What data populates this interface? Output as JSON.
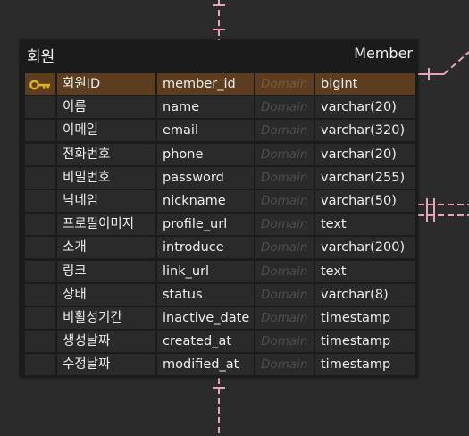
{
  "entity": {
    "logical_name": "회원",
    "physical_name": "Member",
    "domain_placeholder": "Domain",
    "columns": [
      {
        "logical": "회원ID",
        "physical": "member_id",
        "type": "bigint",
        "pk": true
      },
      {
        "logical": "이름",
        "physical": "name",
        "type": "varchar(20)",
        "pk": false
      },
      {
        "logical": "이메일",
        "physical": "email",
        "type": "varchar(320)",
        "pk": false
      },
      {
        "logical": "전화번호",
        "physical": "phone",
        "type": "varchar(20)",
        "pk": false
      },
      {
        "logical": "비밀번호",
        "physical": "password",
        "type": "varchar(255)",
        "pk": false
      },
      {
        "logical": "닉네임",
        "physical": "nickname",
        "type": "varchar(50)",
        "pk": false
      },
      {
        "logical": "프로필이미지",
        "physical": "profile_url",
        "type": "text",
        "pk": false
      },
      {
        "logical": "소개",
        "physical": "introduce",
        "type": "varchar(200)",
        "pk": false
      },
      {
        "logical": "링크",
        "physical": "link_url",
        "type": "text",
        "pk": false
      },
      {
        "logical": "상태",
        "physical": "status",
        "type": "varchar(8)",
        "pk": false
      },
      {
        "logical": "비활성기간",
        "physical": "inactive_date",
        "type": "timestamp",
        "pk": false
      },
      {
        "logical": "생성날짜",
        "physical": "created_at",
        "type": "timestamp",
        "pk": false
      },
      {
        "logical": "수정날짜",
        "physical": "modified_at",
        "type": "timestamp",
        "pk": false
      }
    ]
  },
  "colors": {
    "canvas_bg": "#2b2b2b",
    "entity_bg": "#1b1b1b",
    "row_bg": "#2a2a2a",
    "pk_row_bg": "#5d3d1f",
    "relation_line": "#e8a5b5",
    "key_icon": "#e0b020"
  },
  "icons": {
    "primary_key": "key-icon"
  }
}
